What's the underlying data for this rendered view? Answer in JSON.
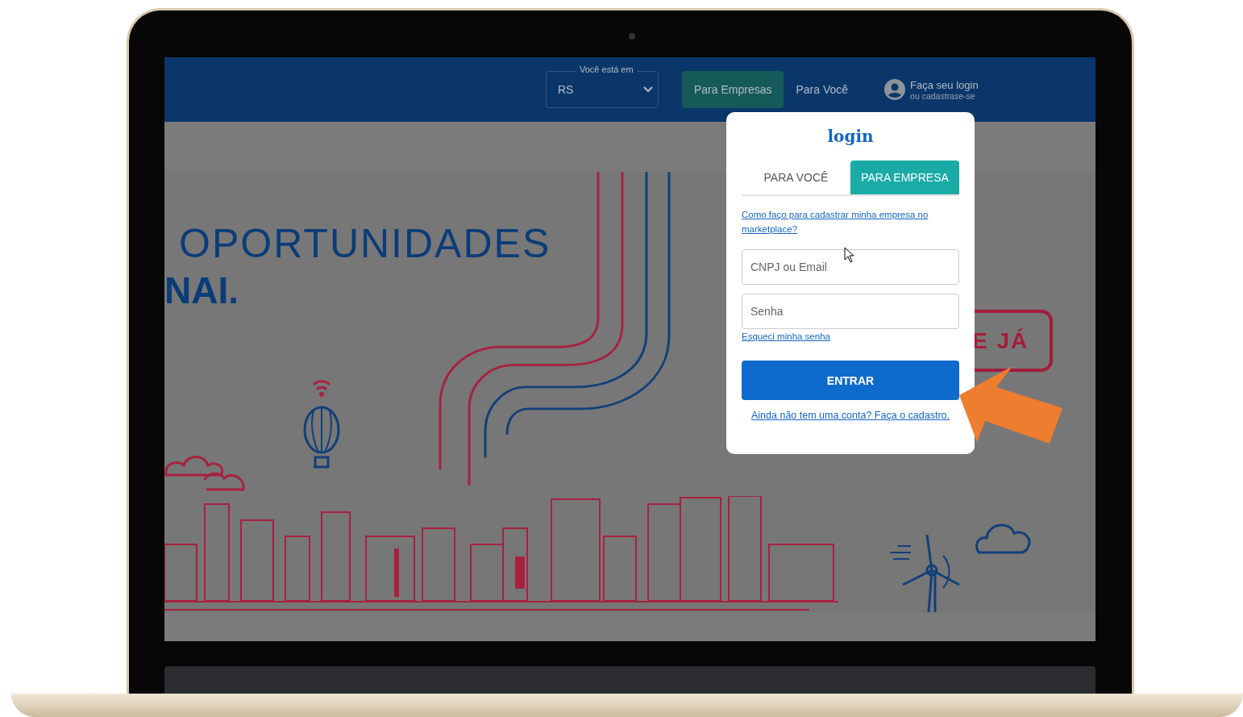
{
  "header": {
    "region_select": {
      "label": "Você está em",
      "value": "RS"
    },
    "nav": [
      {
        "label": "Para Empresas",
        "selected": true
      },
      {
        "label": "Para Você",
        "selected": false
      }
    ],
    "login_link": {
      "title": "Faça seu login",
      "subtitle": "ou cadastrase-se"
    }
  },
  "hero": {
    "headline_1": "OPORTUNIDADES",
    "headline_2": "NAI.",
    "cta": "E JÁ"
  },
  "login": {
    "title": "login",
    "tabs": [
      {
        "label": "PARA VOCÊ",
        "selected": false
      },
      {
        "label": "PARA EMPRESA",
        "selected": true
      }
    ],
    "help_link": "Como faço para cadastrar minha empresa no marketplace?",
    "fields": [
      {
        "placeholder": "CNPJ ou Email"
      },
      {
        "placeholder": "Senha"
      }
    ],
    "forgot_link": "Esqueci minha senha",
    "submit": "ENTRAR",
    "signup_link": "Ainda não tem uma conta? Faça o cadastro."
  }
}
